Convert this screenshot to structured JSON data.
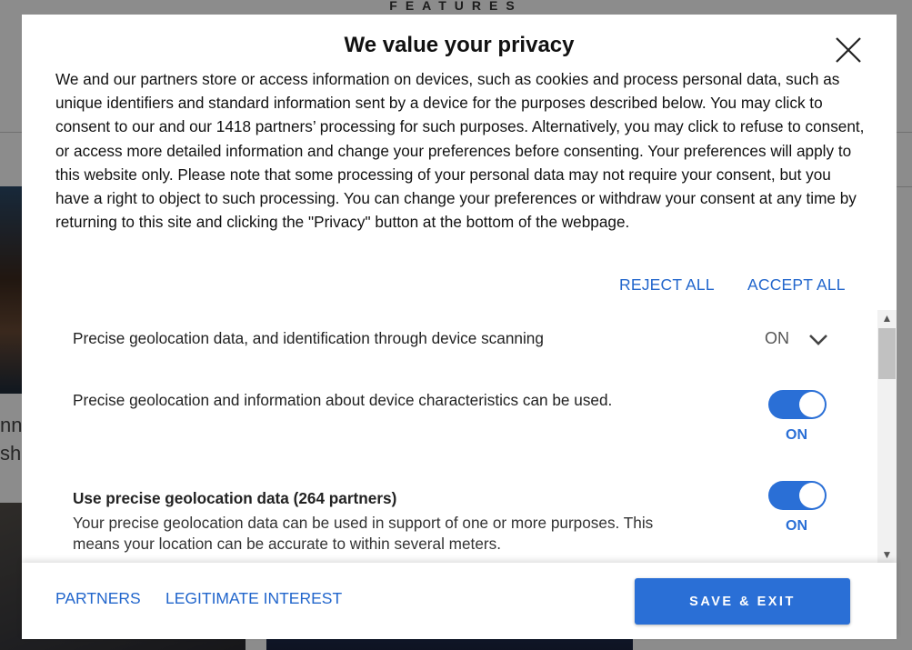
{
  "background": {
    "section_heading": "FEATURES",
    "snippet_line_1": "nn",
    "snippet_line_2": "sha"
  },
  "modal": {
    "title": "We value your privacy",
    "close_icon": "close-icon",
    "intro_text": "We and our partners store or access information on devices, such as cookies and process personal data, such as unique identifiers and standard information sent by a device for the purposes described below. You may click to consent to our and our 1418 partners’ processing for such purposes. Alternatively, you may click to refuse to consent, or access more detailed information and change your preferences before consenting. Your preferences will apply to this website only. Please note that some processing of your personal data may not require your consent, but you have a right to object to such processing. You can change your preferences or withdraw your consent at any time by returning to this site and clicking the \"Privacy\" button at the bottom of the webpage.",
    "reject_all_label": "REJECT ALL",
    "accept_all_label": "ACCEPT ALL"
  },
  "settings": {
    "header_label": "Precise geolocation data, and identification through device scanning",
    "header_status": "ON",
    "expand_icon": "chevron-down-icon",
    "description": "Precise geolocation and information about device characteristics can be used.",
    "main_toggle_label": "ON",
    "main_toggle_on": true,
    "purposes": [
      {
        "title": "Use precise geolocation data (264 partners)",
        "description": "Your precise geolocation data can be used in support of one or more purposes. This means your location can be accurate to within several meters.",
        "toggle_label": "ON",
        "toggle_on": true
      }
    ]
  },
  "footer": {
    "partners_label": "PARTNERS",
    "legitimate_interest_label": "LEGITIMATE INTEREST",
    "save_exit_label": "SAVE & EXIT"
  },
  "colors": {
    "accent": "#2a6fd6",
    "link": "#2266cc",
    "overlay": "rgba(0,0,0,0.45)"
  }
}
